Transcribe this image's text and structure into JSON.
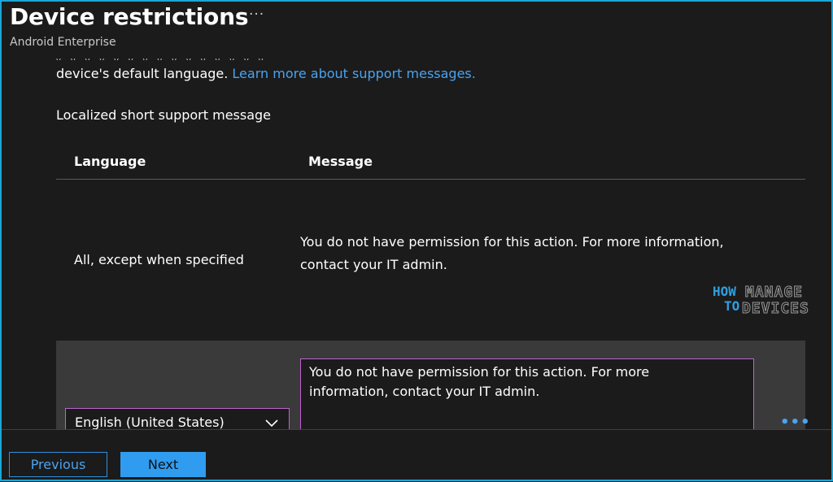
{
  "header": {
    "title": "Device restrictions",
    "subtitle": "Android Enterprise",
    "more_label": "···"
  },
  "content": {
    "clipped_line": "ᵥ ᵥ ᵥ ᵥ ᵥ ᵥ ᵥ ᵥ ᵥ ᵥ ᵥ ᵥ ᵥ ᵥ ᵥ",
    "description": "device's default language. ",
    "learn_more_link": "Learn more about support messages.",
    "field_label": "Localized short support message"
  },
  "table": {
    "headers": [
      "Language",
      "Message"
    ],
    "rows": [
      {
        "language": "All, except when specified",
        "message": "You do not have permission for this action. For more information, contact your IT admin."
      },
      {
        "language": "English (United States)",
        "message": "You do not have permission for this action. For more information, contact your IT admin.",
        "more_label": "•••"
      }
    ]
  },
  "logo": {
    "how": "HOW",
    "to": "TO",
    "manage": "MANAGE",
    "devices": "DEVICES"
  },
  "footer": {
    "previous_label": "Previous",
    "next_label": "Next"
  },
  "colors": {
    "accent": "#2f9cf0",
    "link": "#4aa3f0",
    "focus_border": "#c062d0",
    "frame": "#1aa6d8",
    "background": "#1b1b1b"
  },
  "icons": {
    "more": "ellipsis-icon",
    "dropdown": "chevron-down-icon"
  }
}
